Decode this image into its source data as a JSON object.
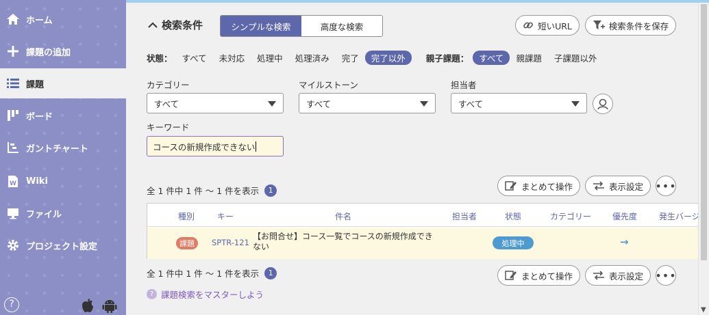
{
  "sidebar": {
    "items": [
      {
        "label": "ホーム",
        "icon": "home-icon"
      },
      {
        "label": "課題の追加",
        "icon": "plus-icon"
      },
      {
        "label": "課題",
        "icon": "list-icon"
      },
      {
        "label": "ボード",
        "icon": "board-icon"
      },
      {
        "label": "ガントチャート",
        "icon": "gantt-icon"
      },
      {
        "label": "Wiki",
        "icon": "wiki-icon"
      },
      {
        "label": "ファイル",
        "icon": "file-icon"
      },
      {
        "label": "プロジェクト設定",
        "icon": "gear-icon"
      }
    ],
    "active_index": 2,
    "help_label": "?"
  },
  "search": {
    "title": "検索条件",
    "tabs": [
      "シンプルな検索",
      "高度な検索"
    ],
    "active_tab": 0,
    "short_url_label": "短いURL",
    "save_label": "検索条件を保存",
    "status_label": "状態：",
    "status_options": [
      "すべて",
      "未対応",
      "処理中",
      "処理済み",
      "完了",
      "完了以外"
    ],
    "status_selected": 5,
    "parent_label": "親子課題：",
    "parent_options": [
      "すべて",
      "親課題",
      "子課題以外"
    ],
    "parent_selected": 0,
    "category_label": "カテゴリー",
    "category_value": "すべて",
    "milestone_label": "マイルストーン",
    "milestone_value": "すべて",
    "assignee_label": "担当者",
    "assignee_value": "すべて",
    "keyword_label": "キーワード",
    "keyword_value": "コースの新規作成できない"
  },
  "results": {
    "count_text": "全 1 件中 1 件 〜 1 件を表示",
    "page": "1",
    "bulk_label": "まとめて操作",
    "display_label": "表示設定",
    "more_label": "•••",
    "columns": [
      "種別",
      "キー",
      "件名",
      "担当者",
      "状態",
      "カテゴリー",
      "優先度",
      "発生バージ"
    ],
    "rows": [
      {
        "type": "課題",
        "key": "SPTR-121",
        "subject": "【お問合せ】コース一覧でコースの新規作成できない",
        "assignee": "",
        "status": "処理中",
        "category": "",
        "priority": "→"
      }
    ]
  },
  "help_link": "課題検索をマスターしよう",
  "colors": {
    "sidebar": "#8b8fc6",
    "accent": "#5d67ab",
    "row_highlight": "#fdf9e1",
    "status": "#4f9bd0",
    "type_badge": "#e07b66"
  }
}
